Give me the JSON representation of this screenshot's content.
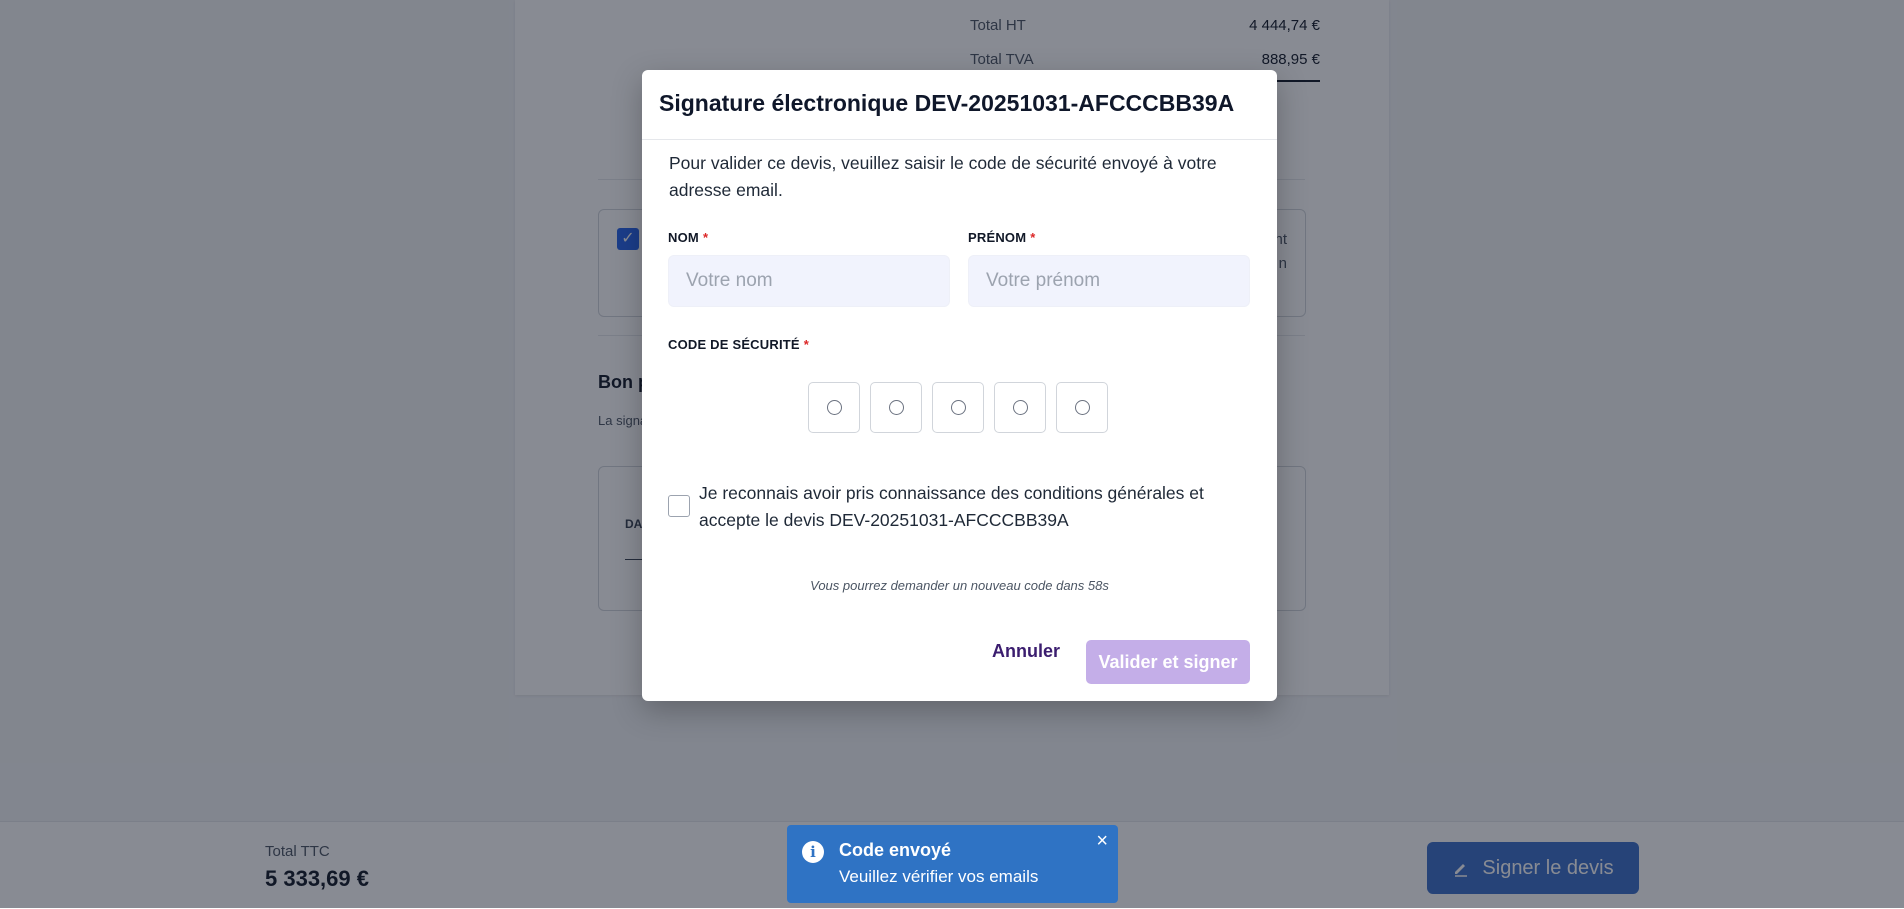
{
  "document": {
    "totals": [
      {
        "label": "Total HT",
        "value": "4 444,74 €"
      },
      {
        "label": "Total TVA",
        "value": "888,95 €"
      }
    ],
    "terms_partial": "nt\nn",
    "bon_title": "Bon p",
    "bon_subtitle": "La signa",
    "signature_label": "DA"
  },
  "bottom_bar": {
    "ttc_label": "Total TTC",
    "ttc_value": "5 333,69 €",
    "sign_button": "Signer le devis",
    "sign_icon": "pen-icon"
  },
  "modal": {
    "title": "Signature électronique DEV-20251031-AFCCCBB39A",
    "intro": "Pour valider ce devis, veuillez saisir le code de sécurité envoyé à votre adresse email.",
    "nom_label": "NOM",
    "nom_placeholder": "Votre nom",
    "prenom_label": "PRÉNOM",
    "prenom_placeholder": "Votre prénom",
    "code_label": "CODE DE SÉCURITÉ",
    "required_mark": "*",
    "code_digits": [
      "○",
      "○",
      "○",
      "○",
      "○"
    ],
    "accept_text": "Je reconnais avoir pris connaissance des conditions générales et accepte le devis DEV-20251031-AFCCCBB39A",
    "resend_text": "Vous pourrez demander un nouveau code dans 58s",
    "cancel_label": "Annuler",
    "submit_label": "Valider et signer"
  },
  "toast": {
    "icon": "info-icon",
    "title": "Code envoyé",
    "message": "Veuillez vérifier vos emails",
    "close": "×"
  },
  "colors": {
    "accent": "#3b6fc9",
    "toast_bg": "#2f73c4",
    "submit_disabled": "#c4aee8",
    "cancel_text": "#3b1d6f",
    "required": "#dc2626"
  }
}
